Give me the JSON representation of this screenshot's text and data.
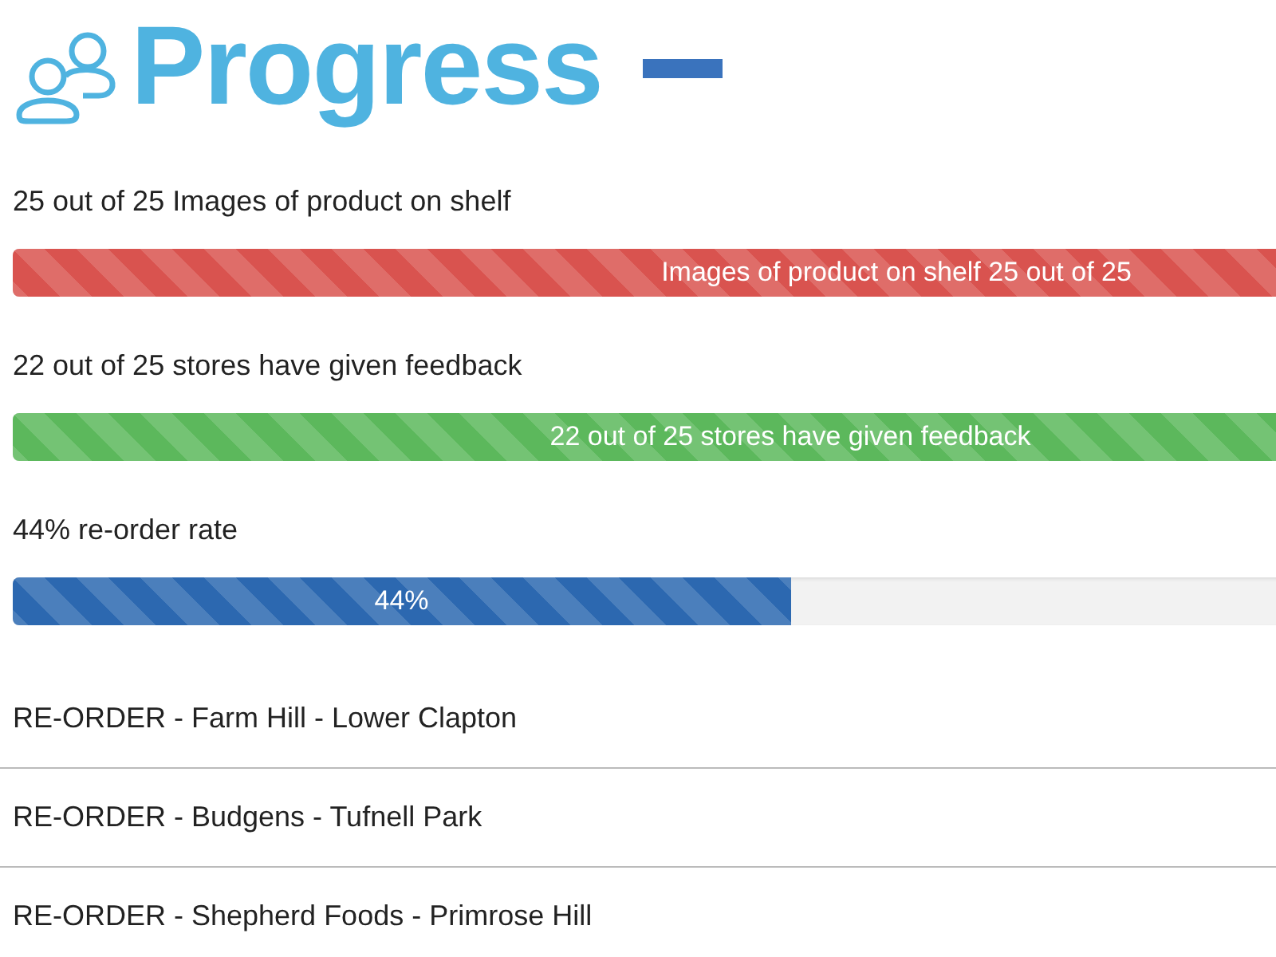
{
  "title": "Progress",
  "bars": [
    {
      "label": "25 out of 25 Images of product on shelf",
      "bar_text": "Images of product on shelf 25 out of 25",
      "level": 1,
      "color": "#d9534f"
    },
    {
      "label": "22 out of 25 stores have given feedback",
      "bar_text": "22 out of 25 stores have given feedback",
      "level": 0.88,
      "color": "#5cb85c"
    },
    {
      "label": "44% re-order rate",
      "bar_text": "44%",
      "level": 0.44,
      "color": "#2c68b0"
    }
  ],
  "reorders": [
    "RE-ORDER - Farm Hill - Lower Clapton",
    "RE-ORDER - Budgens - Tufnell Park",
    "RE-ORDER - Shepherd Foods - Primrose Hill"
  ]
}
